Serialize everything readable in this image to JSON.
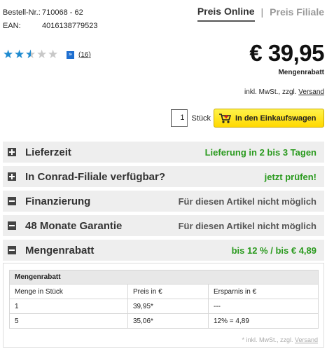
{
  "article": {
    "order_label": "Bestell-Nr.:",
    "order_no": "710068 - 62",
    "ean_label": "EAN:",
    "ean": "4016138779523"
  },
  "tabs": {
    "online": "Preis Online",
    "separator": "|",
    "store": "Preis Filiale"
  },
  "rating": {
    "stars": 2.5,
    "max": 5,
    "count": "(16)",
    "star_color": "#1f8bd0"
  },
  "price": {
    "value": "€ 39,95",
    "note": "Mengenrabatt",
    "vat_text": "inkl. MwSt., zzgl.",
    "vat_link": "Versand"
  },
  "cart": {
    "quantity": "1",
    "unit": "Stück",
    "button": "In den Einkaufswagen"
  },
  "sections": [
    {
      "icon": "plus-icon",
      "label": "Lieferzeit",
      "value": "Lieferung in 2 bis 3 Tagen",
      "value_color": "#2a9a1e"
    },
    {
      "icon": "plus-icon",
      "label": "In Conrad-Filiale verfügbar?",
      "value": "jetzt prüfen!",
      "value_color": "#2a9a1e"
    },
    {
      "icon": "minus-icon",
      "label": "Finanzierung",
      "value": "Für diesen Artikel nicht möglich",
      "value_color": "#555555"
    },
    {
      "icon": "minus-icon",
      "label": "48 Monate Garantie",
      "value": "Für diesen Artikel nicht möglich",
      "value_color": "#555555"
    },
    {
      "icon": "minus-icon",
      "label": "Mengenrabatt",
      "value": "bis 12 % / bis € 4,89",
      "value_color": "#2a9a1e"
    }
  ],
  "discount_table": {
    "title": "Mengenrabatt",
    "headers": [
      "Menge in Stück",
      "Preis in €",
      "Ersparnis in €"
    ],
    "rows": [
      [
        "1",
        "39,95*",
        "---"
      ],
      [
        "5",
        "35,06*",
        "12% = 4,89"
      ]
    ],
    "footnote": "* inkl. MwSt., zzgl.",
    "footnote_link": "Versand"
  }
}
